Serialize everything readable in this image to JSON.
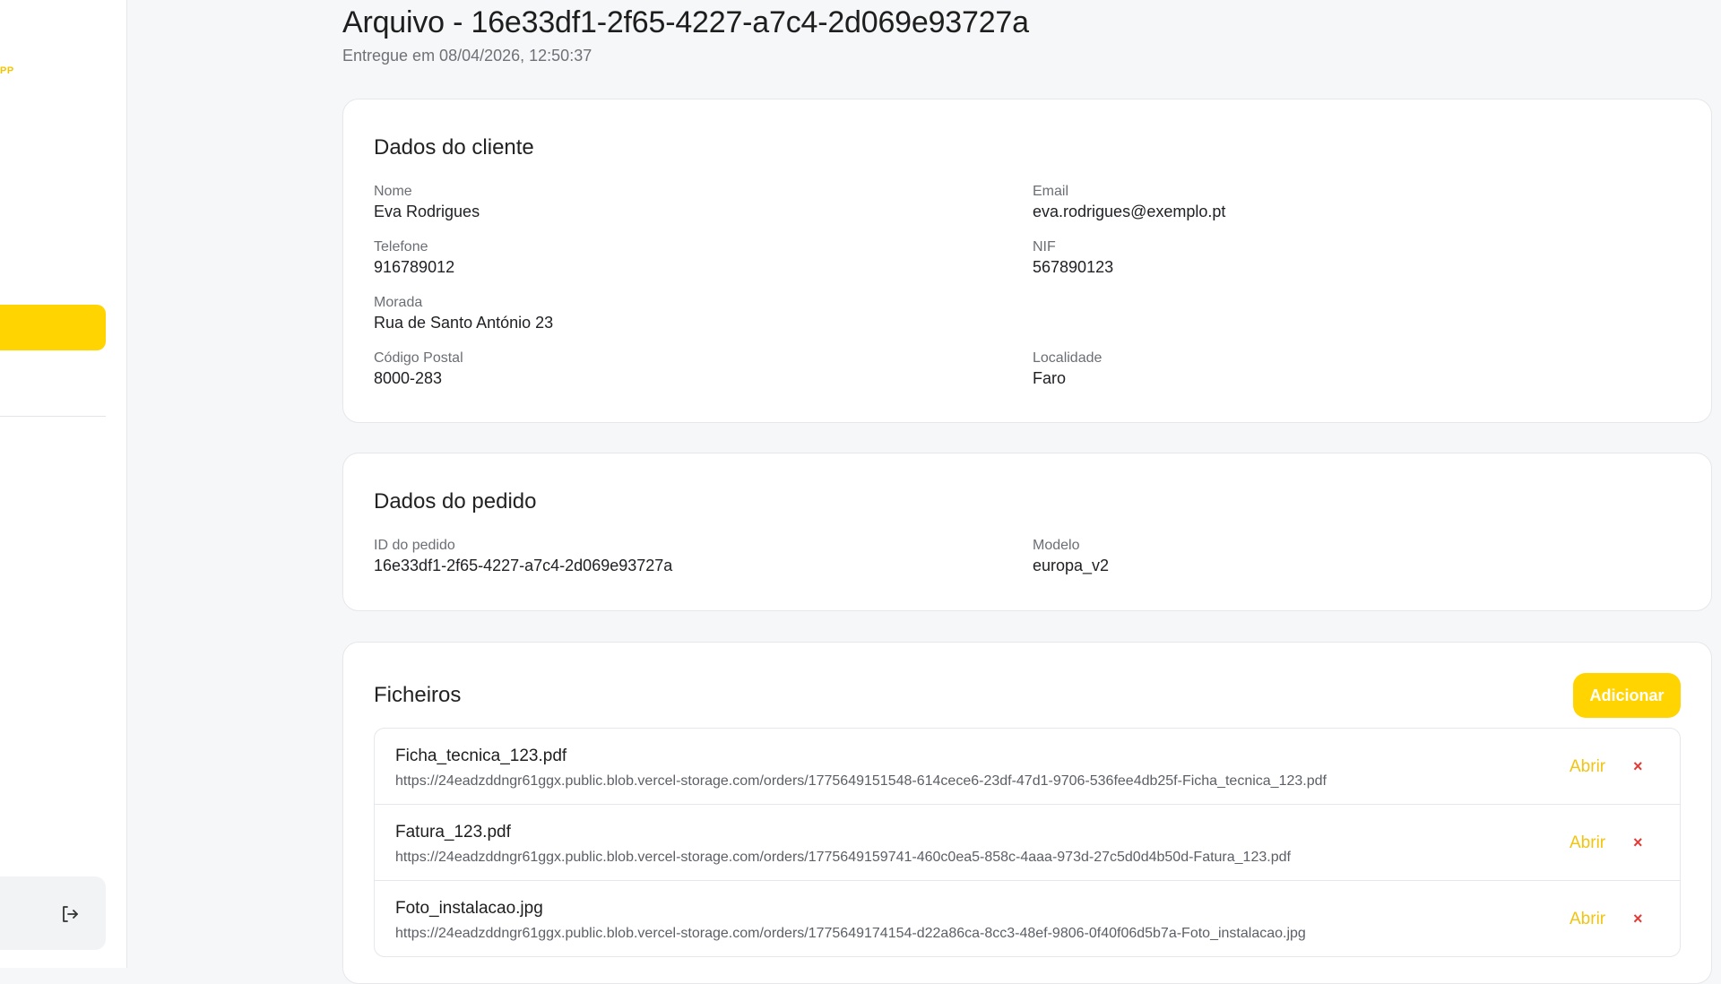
{
  "sidebar": {
    "brand_tag": "PP"
  },
  "header": {
    "title": "Arquivo - 16e33df1-2f65-4227-a7c4-2d069e93727a",
    "subtitle": "Entregue em 08/04/2026, 12:50:37"
  },
  "client": {
    "title": "Dados do cliente",
    "fields": [
      {
        "label": "Nome",
        "value": "Eva Rodrigues"
      },
      {
        "label": "Email",
        "value": "eva.rodrigues@exemplo.pt"
      },
      {
        "label": "Telefone",
        "value": "916789012"
      },
      {
        "label": "NIF",
        "value": "567890123"
      },
      {
        "label": "Morada",
        "value": "Rua de Santo António 23"
      },
      {
        "label": "Código Postal",
        "value": "8000-283"
      },
      {
        "label": "Localidade",
        "value": "Faro"
      }
    ]
  },
  "order": {
    "title": "Dados do pedido",
    "fields": [
      {
        "label": "ID do pedido",
        "value": "16e33df1-2f65-4227-a7c4-2d069e93727a"
      },
      {
        "label": "Modelo",
        "value": "europa_v2"
      }
    ]
  },
  "files": {
    "title": "Ficheiros",
    "add_label": "Adicionar",
    "open_label": "Abrir",
    "delete_label": "×",
    "items": [
      {
        "name": "Ficha_tecnica_123.pdf",
        "url": "https://24eadzddngr61ggx.public.blob.vercel-storage.com/orders/1775649151548-614cece6-23df-47d1-9706-536fee4db25f-Ficha_tecnica_123.pdf"
      },
      {
        "name": "Fatura_123.pdf",
        "url": "https://24eadzddngr61ggx.public.blob.vercel-storage.com/orders/1775649159741-460c0ea5-858c-4aaa-973d-27c5d0d4b50d-Fatura_123.pdf"
      },
      {
        "name": "Foto_instalacao.jpg",
        "url": "https://24eadzddngr61ggx.public.blob.vercel-storage.com/orders/1775649174154-d22a86ca-8cc3-48ef-9806-0f40f06d5b7a-Foto_instalacao.jpg"
      }
    ]
  },
  "colors": {
    "accent": "#ffd400",
    "danger": "#e53935",
    "link": "#f1c40f"
  },
  "icons": {
    "logout": "logout-icon"
  }
}
